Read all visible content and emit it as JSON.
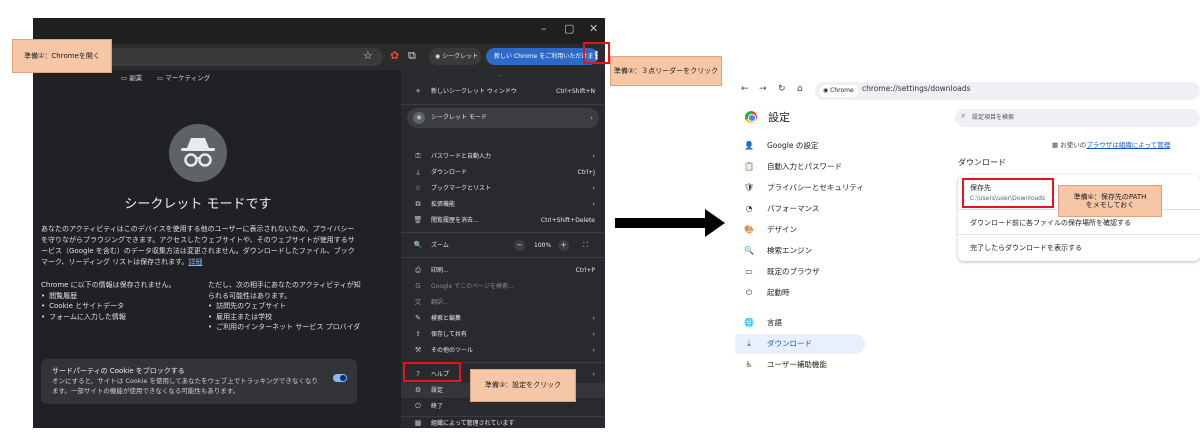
{
  "left_window": {
    "title_controls": [
      "–",
      "▢",
      "✕"
    ],
    "incognito_chip": "シークレット",
    "update_chip": "新しい Chrome をご利用いただけます",
    "bookmarks": [
      "副業",
      "マーケティング"
    ],
    "incognito_title": "シークレット モードです",
    "intro": "あなたのアクティビティはこのデバイスを使用する他のユーザーに表示されないため、プライバシーを守りながらブラウジングできます。アクセスしたウェブサイトや、そのウェブサイトが使用するサービス（Google を含む）のデータ収集方法は変更されません。ダウンロードしたファイル、ブックマーク、リーディング リストは保存されます。",
    "intro_link": "詳細",
    "not_saved_heading": "Chrome に以下の情報は保存されません。",
    "not_saved_items": [
      "閲覧履歴",
      "Cookie とサイトデータ",
      "フォームに入力した情報"
    ],
    "visible_heading": "ただし、次の相手にあなたのアクティビティが知られる可能性はあります。",
    "visible_items": [
      "訪問先のウェブサイト",
      "雇用主または学校",
      "ご利用のインターネット サービス プロバイダ"
    ],
    "cookie_title": "サードパーティの Cookie をブロックする",
    "cookie_desc": "オンにすると、サイトは Cookie を使用してあなたをウェブ上でトラッキングできなくなります。一部サイトの機能が使用できなくなる可能性もあります。"
  },
  "menu": {
    "items": [
      {
        "icon": "+",
        "label": "新しいシークレット ウィンドウ",
        "shortcut": "Ctrl+Shift+N",
        "arrow": "",
        "dim": false
      },
      {
        "icon": "◉",
        "label": "シークレット モード",
        "shortcut": "",
        "arrow": "›",
        "dim": false
      },
      {
        "icon": "⚿",
        "label": "パスワードと自動入力",
        "shortcut": "",
        "arrow": "›",
        "dim": false
      },
      {
        "icon": "⤓",
        "label": "ダウンロード",
        "shortcut": "Ctrl+J",
        "arrow": "",
        "dim": false
      },
      {
        "icon": "☆",
        "label": "ブックマークとリスト",
        "shortcut": "",
        "arrow": "›",
        "dim": false
      },
      {
        "icon": "⧉",
        "label": "拡張機能",
        "shortcut": "",
        "arrow": "›",
        "dim": false
      },
      {
        "icon": "🗑",
        "label": "閲覧履歴を消去...",
        "shortcut": "Ctrl+Shift+Delete",
        "arrow": "",
        "dim": false
      },
      {
        "icon": "🔍",
        "label": "ズーム",
        "shortcut": "",
        "arrow": "",
        "dim": false
      },
      {
        "icon": "⎙",
        "label": "印刷...",
        "shortcut": "Ctrl+P",
        "arrow": "",
        "dim": false
      },
      {
        "icon": "G",
        "label": "Google でこのページを検索...",
        "shortcut": "",
        "arrow": "",
        "dim": true
      },
      {
        "icon": "文",
        "label": "翻訳...",
        "shortcut": "",
        "arrow": "",
        "dim": true
      },
      {
        "icon": "✎",
        "label": "検索と編集",
        "shortcut": "",
        "arrow": "›",
        "dim": false
      },
      {
        "icon": "⇪",
        "label": "保存して共有",
        "shortcut": "",
        "arrow": "›",
        "dim": false
      },
      {
        "icon": "⚒",
        "label": "その他のツール",
        "shortcut": "",
        "arrow": "›",
        "dim": false
      },
      {
        "icon": "?",
        "label": "ヘルプ",
        "shortcut": "",
        "arrow": "›",
        "dim": false
      },
      {
        "icon": "⚙",
        "label": "設定",
        "shortcut": "",
        "arrow": "",
        "dim": false
      },
      {
        "icon": "⏻",
        "label": "終了",
        "shortcut": "",
        "arrow": "",
        "dim": false
      },
      {
        "icon": "▦",
        "label": "組織によって管理されています",
        "shortcut": "",
        "arrow": "",
        "dim": false
      }
    ],
    "zoom_minus": "−",
    "zoom_value": "100%",
    "zoom_plus": "+",
    "fullscreen": "⛶"
  },
  "callouts": {
    "prep1": "準備①：Chromeを開く",
    "prep2": "準備②：３点リーダーをクリック",
    "prep3": "準備③：設定をクリック",
    "prep4_line1": "準備④：保存先のPATH",
    "prep4_line2": "をメモしておく"
  },
  "settings": {
    "chrome_chip": "Chrome",
    "url": "chrome://settings/downloads",
    "title": "設定",
    "search_placeholder": "設定項目を検索",
    "nav": [
      {
        "icon": "👤",
        "label": "Google の設定",
        "active": false
      },
      {
        "icon": "📋",
        "label": "自動入力とパスワード",
        "active": false
      },
      {
        "icon": "🛡",
        "label": "プライバシーとセキュリティ",
        "active": false
      },
      {
        "icon": "◔",
        "label": "パフォーマンス",
        "active": false
      },
      {
        "icon": "🎨",
        "label": "デザイン",
        "active": false
      },
      {
        "icon": "🔍",
        "label": "検索エンジン",
        "active": false
      },
      {
        "icon": "▭",
        "label": "既定のブラウザ",
        "active": false
      },
      {
        "icon": "⏻",
        "label": "起動時",
        "active": false
      },
      {
        "icon": "🌐",
        "label": "言語",
        "active": false
      },
      {
        "icon": "⤓",
        "label": "ダウンロード",
        "active": true
      },
      {
        "icon": "♿",
        "label": "ユーザー補助機能",
        "active": false
      }
    ],
    "managed_prefix": "お使いの",
    "managed_link": "ブラウザは組織によって管理",
    "downloads_heading": "ダウンロード",
    "save_location_label": "保存先",
    "save_location_path": "C:\\Users\\user\\Downloads",
    "ask_where": "ダウンロード前に各ファイルの保存場所を確認する",
    "show_when_done": "完了したらダウンロードを表示する"
  }
}
